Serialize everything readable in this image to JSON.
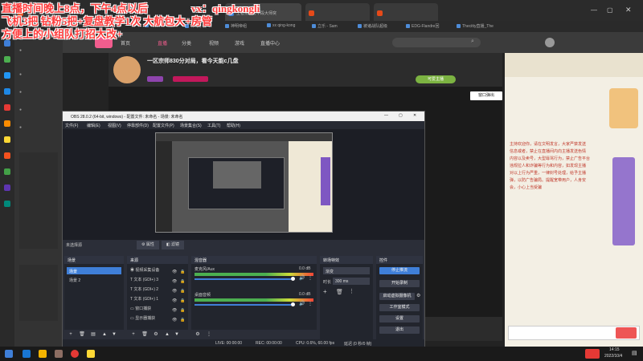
{
  "overlay": {
    "line1_a": "直播时间晚上8点，下午4点以后",
    "line1_b": "vx：qingkongli",
    "line2": "飞机3把 钻粉5把+复盘教学1次 大航包大+房管",
    "line3": "方便上的小组队打招大改+"
  },
  "browser": {
    "tabs": [
      "",
      "王者排星打中段大师突",
      "",
      "",
      "",
      "",
      "",
      "",
      "",
      "",
      "",
      ""
    ],
    "tab_short": [
      "2022-08-25",
      "神马小说 - 免费",
      "神明帝组 - 拯救",
      "xx qing-kong - ",
      "立乐 - 韦乐 - Sam",
      "被诸战队超级爷子",
      "EDG-Flandre回",
      "Thecitty直播_The"
    ],
    "bookmarks": [
      "2022-08-25",
      "神马小说",
      "神明帝组",
      "xx qing-kong",
      "立乐 - Sam",
      "被诸战队超级",
      "EDG-Flandre回",
      "Thecitty直播_The"
    ]
  },
  "site": {
    "nav": [
      "首页",
      "直播",
      "分类",
      "视频",
      "游戏",
      "直播中心"
    ],
    "stream_title": "一区宗师830分对局，看今天能c几盘",
    "badge": "可爱主播",
    "leave_button": "窗口弹出",
    "chat_lines": [
      "主持欢迎你，请在文明发言，大家严禁发送",
      "信息或者，禁止在直播间内向主播发送色情",
      "内容以及卖号，大型辱骂行为，禁止广告平台",
      "违规拉人和诈骗等行为和内容，如发现主播",
      "对以上行为严重，一律封号处理，给予主播",
      "弹，以防广告骗局。提醒宽带用户，人身安",
      "会，小心上当受骗"
    ]
  },
  "obs": {
    "title": "OBS 28.0.2 (64-bit, windows) - 配置文件: 未命名 - 场景: 未命名",
    "menu": [
      "文件(F)",
      "编辑(E)",
      "视图(V)",
      "停靠部件(D)",
      "配置文件(P)",
      "场景集合(S)",
      "工具(T)",
      "帮助(H)"
    ],
    "scene_name": "未选择源",
    "props_label": "属性",
    "filters_label": "滤镜",
    "docks": {
      "scenes": "场景",
      "sources": "来源",
      "mixer": "混音器",
      "transitions": "转场特效",
      "controls": "控件"
    },
    "scenes": [
      "场景",
      "场景 2"
    ],
    "sources": [
      "视频采集设备",
      "文本 (GDI+) 3",
      "文本 (GDI+) 2",
      "文本 (GDI+) 1",
      "窗口捕获",
      "显示器捕获"
    ],
    "mixer": {
      "track1": "麦克风/Aux",
      "track1_db": "0.0 dB",
      "track2": "桌面音频",
      "track2_db": "0.0 dB"
    },
    "transition": {
      "type": "渐变",
      "duration_label": "时长",
      "duration": "300 ms"
    },
    "controls": [
      "停止推流",
      "开始录制",
      "启动虚拟摄像机",
      "工作室模式",
      "设置",
      "退出"
    ],
    "status": {
      "live": "LIVE: 00:00:00",
      "rec": "REC: 00:00:00",
      "cpu": "CPU: 0.6%, 60.00 fps",
      "kbps": "延迟 (0 秒/0 帧)"
    }
  },
  "taskbar": {
    "time": "14:15",
    "date": "2022/10/4"
  },
  "colors": {
    "accent_blue": "#3f7fd8",
    "live_red": "#e02020",
    "overlay_red": "#ff3b3b"
  }
}
